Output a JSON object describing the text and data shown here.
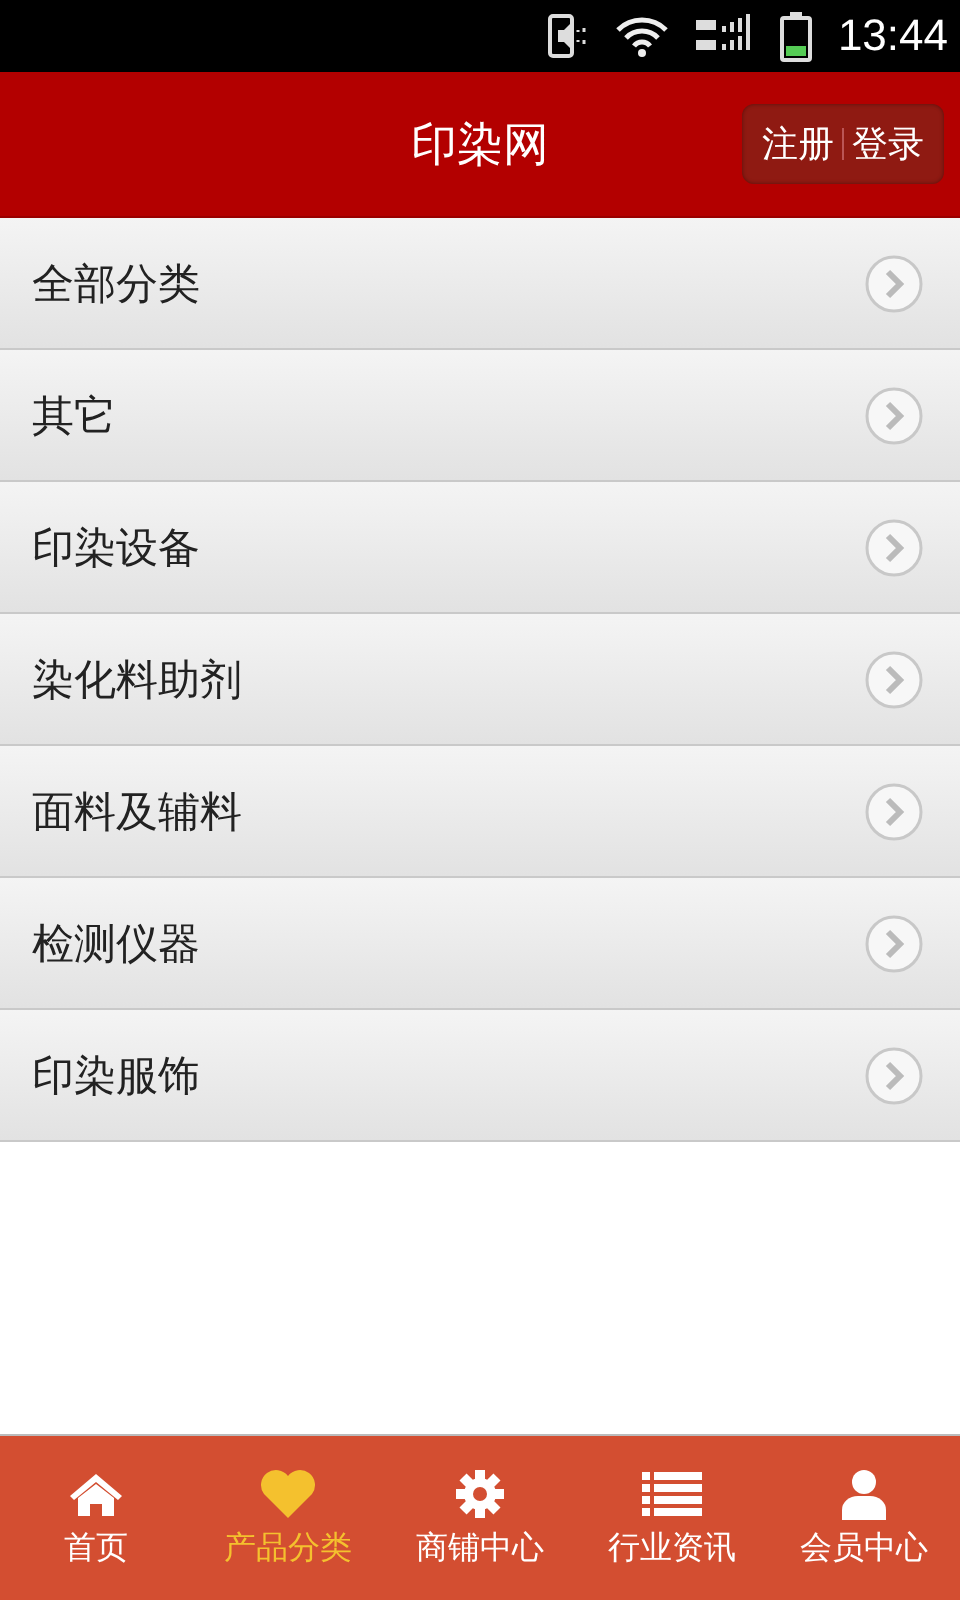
{
  "status_bar": {
    "time": "13:44"
  },
  "header": {
    "title": "印染网",
    "actions": [
      "注册",
      "登录"
    ]
  },
  "categories": [
    {
      "label": "全部分类"
    },
    {
      "label": "其它"
    },
    {
      "label": "印染设备"
    },
    {
      "label": "染化料助剂"
    },
    {
      "label": "面料及辅料"
    },
    {
      "label": "检测仪器"
    },
    {
      "label": "印染服饰"
    }
  ],
  "tab_bar": [
    {
      "label": "首页",
      "kind": "home",
      "selected": false
    },
    {
      "label": "产品分类",
      "kind": "heart",
      "selected": true
    },
    {
      "label": "商铺中心",
      "kind": "gear",
      "selected": false
    },
    {
      "label": "行业资讯",
      "kind": "list",
      "selected": false
    },
    {
      "label": "会员中心",
      "kind": "person",
      "selected": false
    }
  ]
}
